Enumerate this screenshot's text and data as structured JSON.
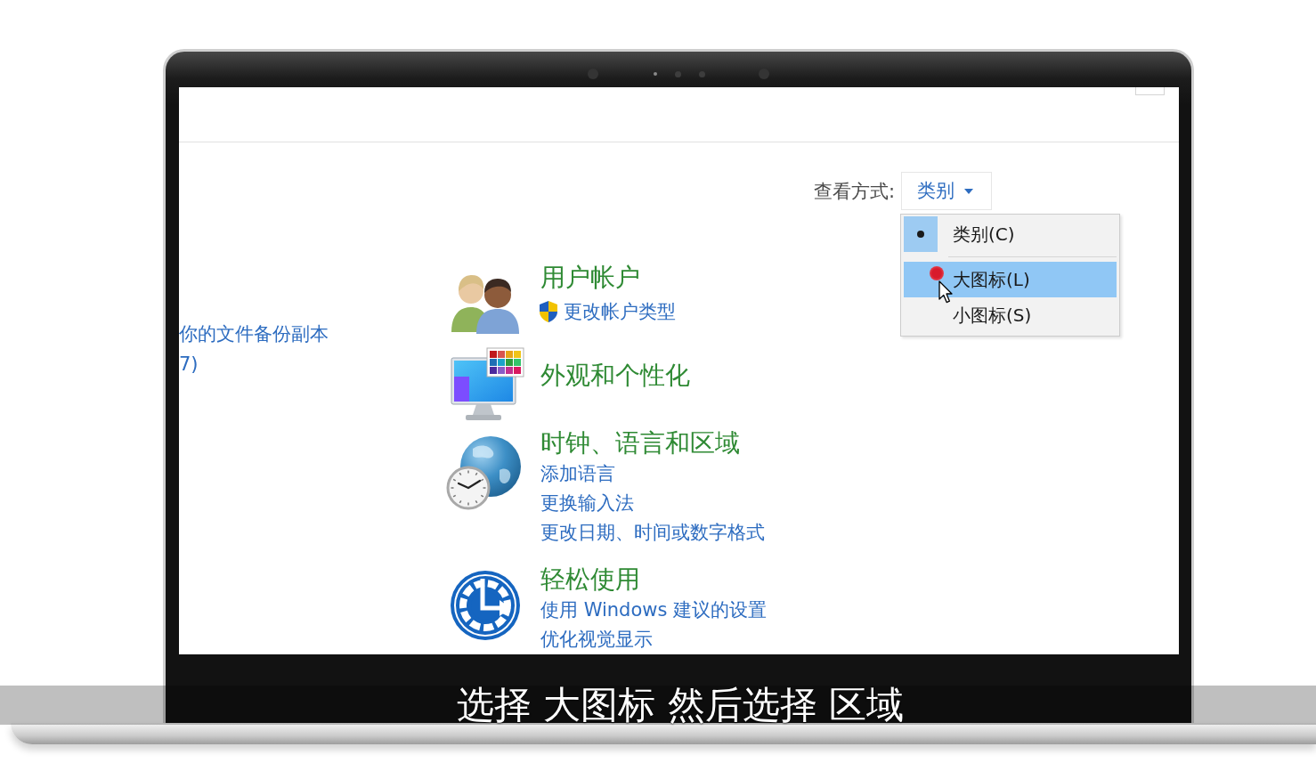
{
  "view_by": {
    "label": "查看方式:",
    "value": "类别",
    "menu_groups": [
      {
        "items": [
          {
            "label": "类别(C)",
            "checked": true,
            "selected": false
          }
        ]
      },
      {
        "items": [
          {
            "label": "大图标(L)",
            "checked": false,
            "selected": true
          },
          {
            "label": "小图标(S)",
            "checked": false,
            "selected": false
          }
        ]
      }
    ]
  },
  "left_links": [
    "你的文件备份副本",
    "7)"
  ],
  "categories": [
    {
      "kind": "users",
      "title": "用户帐户",
      "links": [
        {
          "text": "更改帐户类型",
          "shield": true
        }
      ]
    },
    {
      "kind": "appearance",
      "title": "外观和个性化"
    },
    {
      "kind": "clock",
      "title": "时钟、语言和区域",
      "links": [
        {
          "text": "添加语言",
          "shield": false
        },
        {
          "text": "更换输入法",
          "shield": false
        },
        {
          "text": "更改日期、时间或数字格式",
          "shield": false
        }
      ]
    },
    {
      "kind": "ease",
      "title": "轻松使用",
      "links": [
        {
          "text": "使用 Windows 建议的设置",
          "shield": false
        },
        {
          "text": "优化视觉显示",
          "shield": false
        }
      ]
    }
  ],
  "caption": "选择 大图标 然后选择 区域"
}
